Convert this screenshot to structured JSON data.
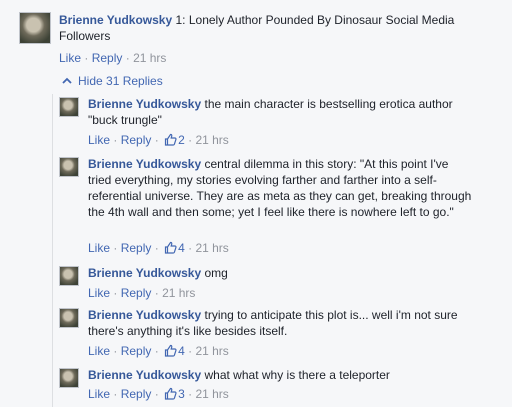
{
  "top_comment": {
    "author": "Brienne Yudkowsky",
    "text": "1: Lonely Author Pounded By Dinosaur Social Media Followers",
    "like": "Like",
    "reply": "Reply",
    "time": "21 hrs"
  },
  "replies_toggle": "Hide 31 Replies",
  "separator": "·",
  "replies": [
    {
      "author": "Brienne Yudkowsky",
      "text": "the main character is bestselling erotica author \"buck trungle\"",
      "like": "Like",
      "reply": "Reply",
      "likes": "2",
      "time": "21 hrs"
    },
    {
      "author": "Brienne Yudkowsky",
      "text": "central dilemma in this story: \"At this point I've tried everything, my stories evolving farther and farther into a self-referential universe. They are as meta as they can get, breaking through the 4th wall and then some; yet I feel like there is nowhere left to go.\"",
      "like": "Like",
      "reply": "Reply",
      "likes": "4",
      "time": "21 hrs"
    },
    {
      "author": "Brienne Yudkowsky",
      "text": "omg",
      "like": "Like",
      "reply": "Reply",
      "likes": "",
      "time": "21 hrs"
    },
    {
      "author": "Brienne Yudkowsky",
      "text": "trying to anticipate this plot is... well i'm not sure there's anything it's like besides itself.",
      "like": "Like",
      "reply": "Reply",
      "likes": "4",
      "time": "21 hrs"
    },
    {
      "author": "Brienne Yudkowsky",
      "text": "what what why is there a teleporter",
      "like": "Like",
      "reply": "Reply",
      "likes": "3",
      "time": "21 hrs"
    }
  ]
}
